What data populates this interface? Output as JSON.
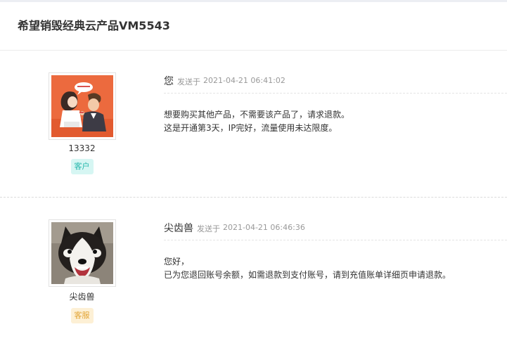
{
  "ticket": {
    "title": "希望销毁经典云产品VM5543"
  },
  "messages": [
    {
      "sender": "您",
      "sent_prefix": "发送于",
      "time": "2021-04-21 06:41:02",
      "user_name": "13332",
      "role": "客户",
      "avatar_icon": "cartoon-couple-avatar-icon",
      "lines": [
        "想要购买其他产品，不需要该产品了，请求退款。",
        "这是开通第3天，IP完好，流量使用未达限度。"
      ]
    },
    {
      "sender": "尖齿兽",
      "sent_prefix": "发送于",
      "time": "2021-04-21 06:46:36",
      "user_name": "尖齿兽",
      "role": "客服",
      "avatar_icon": "husky-dog-avatar-icon",
      "lines": [
        "您好，",
        "已为您退回账号余额，如需退款到支付账号，请到充值账单详细页申请退款。"
      ]
    }
  ],
  "colors": {
    "customer_badge_bg": "#d6f6f3",
    "customer_badge_text": "#25b7ac",
    "staff_badge_bg": "#fdf0d5",
    "staff_badge_text": "#e2a435"
  }
}
